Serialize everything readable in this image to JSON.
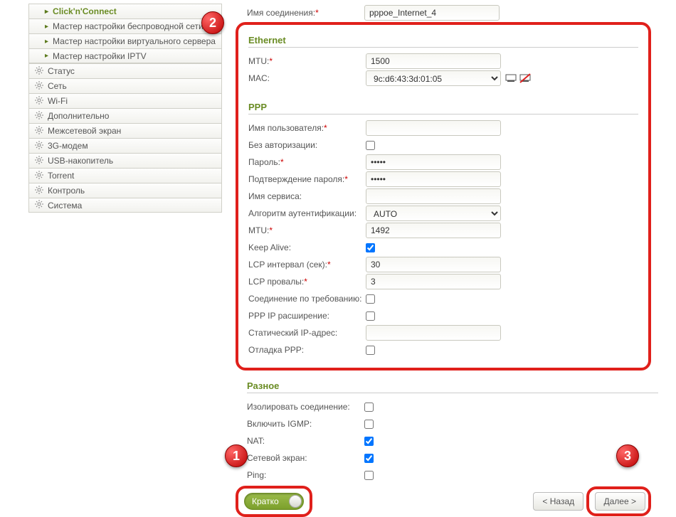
{
  "sidebar": {
    "submenus": [
      {
        "label": "Click'n'Connect",
        "active": true
      },
      {
        "label": "Мастер настройки беспроводной сети",
        "active": false
      },
      {
        "label": "Мастер настройки виртуального сервера",
        "active": false
      },
      {
        "label": "Мастер настройки IPTV",
        "active": false
      }
    ],
    "items": [
      {
        "label": "Статус"
      },
      {
        "label": "Сеть"
      },
      {
        "label": "Wi-Fi"
      },
      {
        "label": "Дополнительно"
      },
      {
        "label": "Межсетевой экран"
      },
      {
        "label": "3G-модем"
      },
      {
        "label": "USB-накопитель"
      },
      {
        "label": "Torrent"
      },
      {
        "label": "Контроль"
      },
      {
        "label": "Система"
      }
    ]
  },
  "top": {
    "conn_name_label": "Имя соединения:",
    "conn_name_value": "pppoe_Internet_4"
  },
  "ethernet": {
    "title": "Ethernet",
    "mtu_label": "MTU:",
    "mtu_value": "1500",
    "mac_label": "MAC:",
    "mac_value": "9c:d6:43:3d:01:05"
  },
  "ppp": {
    "title": "PPP",
    "username_label": "Имя пользователя:",
    "username_value": "",
    "noauth_label": "Без авторизации:",
    "noauth_checked": false,
    "password_label": "Пароль:",
    "password_value": "•••••",
    "password_confirm_label": "Подтверждение пароля:",
    "password_confirm_value": "•••••",
    "service_label": "Имя сервиса:",
    "service_value": "",
    "auth_alg_label": "Алгоритм аутентификации:",
    "auth_alg_value": "AUTO",
    "mtu_label": "MTU:",
    "mtu_value": "1492",
    "keepalive_label": "Keep Alive:",
    "keepalive_checked": true,
    "lcp_interval_label": "LCP интервал (сек):",
    "lcp_interval_value": "30",
    "lcp_fail_label": "LCP провалы:",
    "lcp_fail_value": "3",
    "ondemand_label": "Соединение по требованию:",
    "ondemand_checked": false,
    "ipext_label": "PPP IP расширение:",
    "ipext_checked": false,
    "static_ip_label": "Статический IP-адрес:",
    "static_ip_value": "",
    "debug_label": "Отладка PPP:",
    "debug_checked": false
  },
  "misc": {
    "title": "Разное",
    "isolate_label": "Изолировать соединение:",
    "isolate_checked": false,
    "igmp_label": "Включить IGMP:",
    "igmp_checked": false,
    "nat_label": "NAT:",
    "nat_checked": true,
    "fw_label": "Сетевой экран:",
    "fw_checked": true,
    "ping_label": "Ping:",
    "ping_checked": false
  },
  "buttons": {
    "toggle": "Кратко",
    "back": "< Назад",
    "next": "Далее >"
  },
  "markers": {
    "m1": "1",
    "m2": "2",
    "m3": "3"
  }
}
